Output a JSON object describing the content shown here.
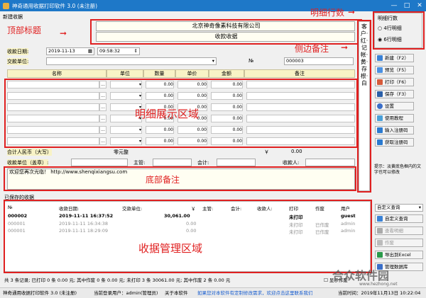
{
  "window": {
    "title": "神奇通用收据打印软件 3.0 (未注册)",
    "minimize": "—",
    "maximize": "□",
    "close": "✕"
  },
  "section_new": "新建收据",
  "annotations": {
    "top_title": "顶部标题",
    "detail_rows": "明细行数",
    "side_note": "侧边备注",
    "detail_area": "明细展示区域",
    "bottom_note": "底部备注",
    "data_area": "收据管理区域"
  },
  "receipt": {
    "company": "北京神奇像素科技有限公司",
    "doc_title": "收款收据",
    "date_label": "收款日期:",
    "date_value": "2019-11-13",
    "time_value": "09:58:32",
    "payer_label": "交款单位:",
    "no_label": "№",
    "no_value": "000003"
  },
  "table": {
    "headers": [
      "名称",
      "单位",
      "数量",
      "单价",
      "金额",
      "备注"
    ],
    "rows": [
      {
        "qty": "0.00",
        "price": "0.00",
        "amount": "0.00"
      },
      {
        "qty": "0.00",
        "price": "0.00",
        "amount": "0.00"
      },
      {
        "qty": "0.00",
        "price": "0.00",
        "amount": "0.00"
      },
      {
        "qty": "0.00",
        "price": "0.00",
        "amount": "0.00"
      },
      {
        "qty": "0.00",
        "price": "0.00",
        "amount": "0.00"
      },
      {
        "qty": "0.00",
        "price": "0.00",
        "amount": "0.00"
      }
    ],
    "ellipsis": "...",
    "total_label": "合计人民币（大写）",
    "total_upper": "零元整",
    "yen": "￥",
    "total_value": "0.00",
    "seal_label": "收款单位（盖章）:",
    "manager_label": "主管:",
    "accountant_label": "会计:",
    "receiver_label": "收款人:"
  },
  "bottom_note": "欢迎您再次光临！ http://www.shenqixiangsu.com",
  "side_note_text": "客户·红·记帐·黄·存根·白",
  "rows_group": {
    "title": "明细行数",
    "opt4": "4行明细",
    "opt6": "6行明细",
    "selected": "6行明细"
  },
  "buttons": [
    "新建（F2）",
    "预览（F5）",
    "打印（F6）",
    "保存（F3）",
    "设置",
    "使用教程",
    "输入注册码",
    "获取注册码"
  ],
  "hint": "提示：淡黄底色框内的文字也可以修改",
  "saved": {
    "title": "已保存的收据",
    "headers": [
      "№",
      "收款日期:",
      "交款单位:",
      "￥",
      "主管:",
      "会计:",
      "收款人:",
      "打印",
      "作废",
      "用户"
    ],
    "rows": [
      {
        "no": "000002",
        "date": "2019-11-11 16:37:52",
        "amount": "30,061.00",
        "print": "未打印",
        "void": "",
        "user": "guest"
      },
      {
        "no": "000001",
        "date": "2019-11-11 16:34:38",
        "amount": "0.00",
        "print": "未打印",
        "void": "已作废",
        "user": "admin"
      },
      {
        "no": "000001",
        "date": "2019-11-11 18:29:09",
        "amount": "0.00",
        "print": "未打印",
        "void": "已作废",
        "user": "admin"
      }
    ]
  },
  "right_panel": {
    "select_value": "自定义查询",
    "buttons": [
      "自定义查询",
      "查看明细",
      "作废",
      "导出到Excel",
      "管理数据库"
    ]
  },
  "summary": "共 3 条记录;   已打印 0 条 0.00 元; 其中作废 0 条 0.00 元;   未打印 3 条 30061.00 元; 其中作废 2 条 0.00 元",
  "show_void": "显示作废",
  "status": {
    "app": "神奇通用收据打印软件 3.0 (未注册)",
    "user": "当前登录用户：admin(管理员)",
    "about": "关于本软件",
    "link": "如果您对本软件有定制修改需求，欢迎点击这里联系我们",
    "time": "当前时间：2019年11月13日 10:22:04"
  },
  "watermark": {
    "logo": "合众软件园",
    "url": "www.hezhong.net"
  }
}
